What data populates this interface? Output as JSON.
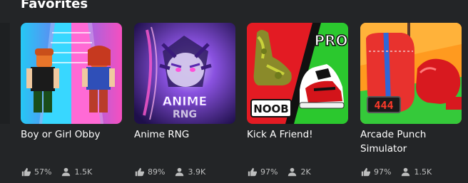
{
  "section": {
    "title": "Favorites"
  },
  "games": [
    {
      "name": "Boy or Girl Obby",
      "rating": "57%",
      "players": "1.5K"
    },
    {
      "name": "Anime RNG",
      "rating": "89%",
      "players": "3.9K",
      "thumb_text_1": "ANIME",
      "thumb_text_2": "RNG"
    },
    {
      "name": "Kick A Friend!",
      "rating": "97%",
      "players": "2K",
      "thumb_text_pro": "PRO",
      "thumb_text_noob": "NOOB"
    },
    {
      "name": "Arcade Punch Simulator",
      "rating": "97%",
      "players": "1.5K",
      "thumb_text_score": "444"
    }
  ],
  "icons": {
    "rating": "thumbs-up-icon",
    "players": "person-icon"
  },
  "colors": {
    "background": "#232527",
    "text": "#ffffff",
    "stat_text": "#bdbebe"
  }
}
